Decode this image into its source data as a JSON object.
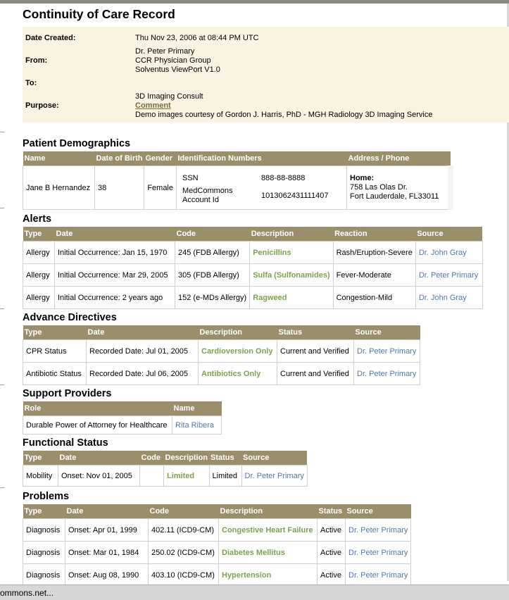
{
  "title": "Continuity of Care Record",
  "header": {
    "date_created_label": "Date Created:",
    "date_created": "Thu Nov 23, 2006 at 08:44 PM UTC",
    "from_label": "From:",
    "from_lines": [
      "Dr. Peter Primary",
      "CCR Physician Group",
      "Solventus ViewPort V1.0"
    ],
    "to_label": "To:",
    "purpose_label": "Purpose:",
    "purpose_line1": "3D Imaging Consult",
    "purpose_link": "Comment",
    "purpose_line3": "Demo images courtesy of Gordon J. Harris, PhD - MGH Radiology 3D Imaging Service"
  },
  "demographics": {
    "heading": "Patient Demographics",
    "columns": [
      "Name",
      "Date of Birth",
      "Gender",
      "Identification Numbers",
      "Address / Phone"
    ],
    "name": "Jane B Hernandez",
    "dob": "38",
    "gender": "Female",
    "id_labels": [
      "SSN",
      "MedCommons Account Id"
    ],
    "id_values": [
      "888-88-8888",
      "1013062431111407"
    ],
    "address_label": "Home:",
    "address_lines": [
      "758 Las Olas Dr.",
      "Fort Lauderdale, FL33011"
    ]
  },
  "alerts": {
    "heading": "Alerts",
    "columns": [
      "Type",
      "Date",
      "Code",
      "Description",
      "Reaction",
      "Source"
    ],
    "rows": [
      {
        "type": "Allergy",
        "date": "Initial Occurrence: Jan 15, 1970",
        "code": "245 (FDB Allergy)",
        "description": "Penicillins",
        "reaction": "Rash/Eruption-Severe",
        "source": "Dr. John Gray"
      },
      {
        "type": "Allergy",
        "date": "Initial Occurrence: Mar 29, 2005",
        "code": "305 (FDB Allergy)",
        "description": "Sulfa (Sulfonamides)",
        "reaction": "Fever-Moderate",
        "source": "Dr. Peter Primary"
      },
      {
        "type": "Allergy",
        "date": "Initial Occurrence: 2 years ago",
        "code": "152 (e-MDs Allergy)",
        "description": "Ragweed",
        "reaction": "Congestion-Mild",
        "source": "Dr. John Gray"
      }
    ]
  },
  "directives": {
    "heading": "Advance Directives",
    "columns": [
      "Type",
      "Date",
      "Description",
      "Status",
      "Source"
    ],
    "rows": [
      {
        "type": "CPR Status",
        "date": "Recorded Date: Jul 01, 2005",
        "description": "Cardioversion Only",
        "status": "Current and Verified",
        "source": "Dr. Peter Primary"
      },
      {
        "type": "Antibiotic Status",
        "date": "Recorded Date: Jul 06, 2005",
        "description": "Antibiotics Only",
        "status": "Current and Verified",
        "source": "Dr. Peter Primary"
      }
    ]
  },
  "support": {
    "heading": "Support Providers",
    "columns": [
      "Role",
      "Name"
    ],
    "rows": [
      {
        "role": "Durable Power of Attorney for Healthcare",
        "name": "Rita Ribera"
      }
    ]
  },
  "functional": {
    "heading": "Functional Status",
    "columns": [
      "Type",
      "Date",
      "Code",
      "Description",
      "Status",
      "Source"
    ],
    "rows": [
      {
        "type": "Mobility",
        "date": "Onset: Nov 01, 2005",
        "code": "",
        "description": "Limited",
        "status": "Limited",
        "source": "Dr. Peter Primary"
      }
    ]
  },
  "problems": {
    "heading": "Problems",
    "columns": [
      "Type",
      "Date",
      "Code",
      "Description",
      "Status",
      "Source"
    ],
    "rows": [
      {
        "type": "Diagnosis",
        "date": "Onset: Apr 01, 1999",
        "code": "402.11 (ICD9-CM)",
        "description": "Congestive Heart Failure",
        "status": "Active",
        "source": "Dr. Peter Primary"
      },
      {
        "type": "Diagnosis",
        "date": "Onset: Mar 01, 1984",
        "code": "250.02 (ICD9-CM)",
        "description": "Diabetes Mellitus",
        "status": "Active",
        "source": "Dr. Peter Primary"
      },
      {
        "type": "Diagnosis",
        "date": "Onset: Aug 08, 1990",
        "code": "403.10 (ICD9-CM)",
        "description": "Hypertension",
        "status": "Active",
        "source": "Dr. Peter Primary"
      }
    ]
  },
  "statusbar": {
    "text": "ommons.net..."
  }
}
